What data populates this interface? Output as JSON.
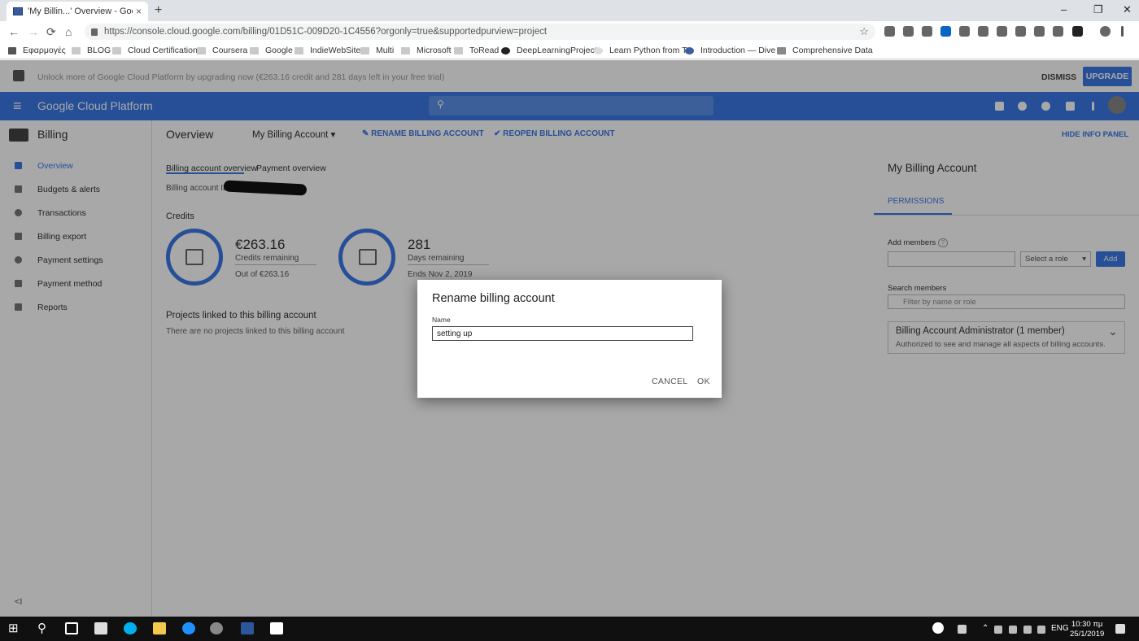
{
  "browser": {
    "tab_title": "'My Billin...' Overview - Google C",
    "tab_close": "×",
    "new_tab": "+",
    "minimize": "–",
    "maximize": "❐",
    "close": "✕",
    "back": "←",
    "forward": "→",
    "reload": "⟳",
    "home": "⌂",
    "url": "https://console.cloud.google.com/billing/01D51C-009D20-1C4556?orgonly=true&supportedpurview=project",
    "star": "☆",
    "bookmarks": [
      "Εφαρμογές",
      "BLOG",
      "Cloud Certifications",
      "Coursera",
      "Google",
      "IndieWebSite",
      "Multi",
      "Microsoft",
      "ToRead",
      "DeepLearningProject",
      "Learn Python from Tr",
      "Introduction — Dive",
      "Comprehensive Data"
    ]
  },
  "promo": {
    "text": "Unlock more of Google Cloud Platform by upgrading now (€263.16 credit and 281 days left in your free trial)",
    "dismiss": "DISMISS",
    "upgrade": "UPGRADE"
  },
  "header": {
    "menu": "≡",
    "title": "Google Cloud Platform",
    "search_icon": "⚲"
  },
  "sidebar": {
    "title": "Billing",
    "items": [
      "Overview",
      "Budgets & alerts",
      "Transactions",
      "Billing export",
      "Payment settings",
      "Payment method",
      "Reports"
    ],
    "collapse": "<I"
  },
  "main": {
    "title": "Overview",
    "account_selector": "My Billing Account",
    "dropdown_arrow": "▾",
    "rename_action": "RENAME BILLING ACCOUNT",
    "reopen_action": "REOPEN BILLING ACCOUNT",
    "hide_info": "HIDE INFO PANEL",
    "tabs": [
      "Billing account overview",
      "Payment overview"
    ],
    "account_id_label": "Billing account ID",
    "credits_heading": "Credits",
    "credits_value": "€263.16",
    "credits_label": "Credits remaining",
    "credits_total": "Out of €263.16",
    "days_value": "281",
    "days_label": "Days remaining",
    "days_end": "Ends Nov 2, 2019",
    "projects_heading": "Projects linked to this billing account",
    "projects_empty": "There are no projects linked to this billing account"
  },
  "info_panel": {
    "title": "My Billing Account",
    "tab": "PERMISSIONS",
    "add_members_label": "Add members",
    "help_icon": "?",
    "role_placeholder": "Select a role",
    "add_button": "Add",
    "search_label": "Search members",
    "search_placeholder": "Filter by name or role",
    "role_title": "Billing Account Administrator (1 member)",
    "role_desc": "Authorized to see and manage all aspects of billing accounts.",
    "expand": "⌄"
  },
  "dialog": {
    "title": "Rename billing account",
    "name_label": "Name",
    "name_value": "setting up",
    "cancel": "CANCEL",
    "ok": "OK"
  },
  "taskbar": {
    "lang": "ENG",
    "time": "10:30 πμ",
    "date": "25/1/2019",
    "start": "⊞",
    "search": "⚲"
  },
  "colors": {
    "accent": "#3b78e7",
    "overlay": "rgba(0,0,0,0.34)"
  }
}
